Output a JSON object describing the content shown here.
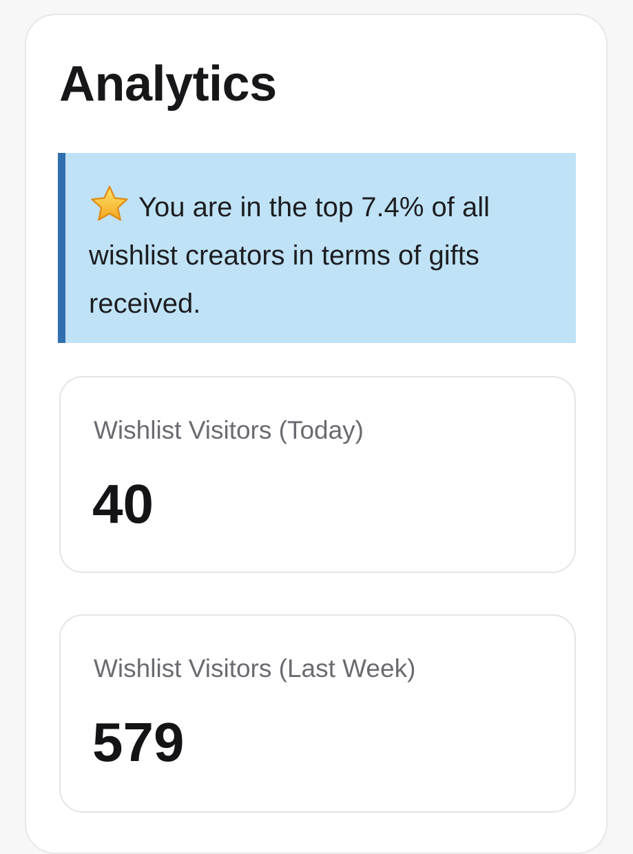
{
  "page": {
    "title": "Analytics"
  },
  "callout": {
    "icon": "star-icon",
    "text": "You are in the top 7.4% of all wishlist creators in terms of gifts received.",
    "accent_color": "#2f6fb0",
    "background_color": "#bfe2f6"
  },
  "stats": [
    {
      "label": "Wishlist Visitors (Today)",
      "value": "40"
    },
    {
      "label": "Wishlist Visitors (Last Week)",
      "value": "579"
    }
  ]
}
